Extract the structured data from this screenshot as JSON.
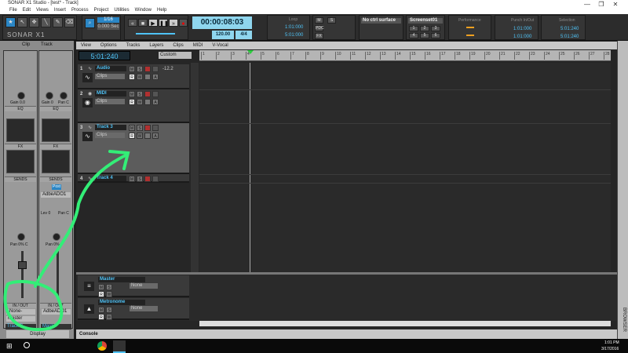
{
  "window": {
    "title": "SONAR X1 Studio - [test* - Track]",
    "minimize": "—",
    "restore": "❐",
    "close": "✕"
  },
  "menu": [
    "File",
    "Edit",
    "Views",
    "Insert",
    "Process",
    "Project",
    "Utilities",
    "Window",
    "Help"
  ],
  "toolbar": {
    "logo": "SONAR X1",
    "snap_value": "1/16",
    "snap_sec": "0.000 Sec",
    "time": "00:00:08:03",
    "tempo": "120.00",
    "meter": "4/4",
    "loop_label": "Loop",
    "loop_start": "1:01:000",
    "loop_end": "5:01:000",
    "ctrl_surface": "No ctrl surface",
    "screenset": "Screenset01",
    "screenset_buttons": [
      "1",
      "2",
      "3",
      "4",
      "5",
      "6"
    ],
    "performance_label": "Performance",
    "punch_label": "Punch In/Out",
    "punch_start": "1:01:000",
    "punch_end": "1:01:000",
    "selection_label": "Selection",
    "sel_start": "5:01:240",
    "sel_end": "5:01:240",
    "mute": "M",
    "solo": "S",
    "pdc": "PDC",
    "fx": "FX"
  },
  "inspector": {
    "tabs": [
      "Clip",
      "Track"
    ],
    "gain_left": "Gain 0.0",
    "gain_right": "Gain 0",
    "pan_right_top": "Pan C",
    "eq": "EQ",
    "fx": "FX",
    "sends": "SENDS",
    "send_post": "Post",
    "send_target": "AdbeADO1",
    "send_lev": "Lev 0",
    "send_pan": "Pan C",
    "pan_left": "Pan 0% C",
    "pan_right": "Pan 0%",
    "in_out": "IN / OUT",
    "input_left": "-None-",
    "output_left": "Master",
    "input_right": "AdbeADO1",
    "strip_name_left": "Track 3",
    "strip_name_right": "Master",
    "display": "Display"
  },
  "trackview": {
    "menus": [
      "View",
      "Options",
      "Tracks",
      "Layers",
      "Clips",
      "MIDI",
      "V-Vocal"
    ],
    "clock": "5:01:240",
    "custom": "Custom",
    "ruler": [
      "1",
      "2",
      "3",
      "4",
      "5",
      "6",
      "7",
      "8",
      "9",
      "10",
      "11",
      "12",
      "13",
      "14",
      "15",
      "16",
      "17",
      "18",
      "19",
      "20",
      "21",
      "22",
      "23",
      "24",
      "25",
      "26",
      "27",
      "28"
    ],
    "tracks": [
      {
        "num": "1",
        "name": "Audio",
        "clip": "Clips",
        "level": "-12.2"
      },
      {
        "num": "2",
        "name": "MIDI",
        "clip": "Clips",
        "level": ""
      },
      {
        "num": "3",
        "name": "Track 3",
        "clip": "Clips",
        "level": ""
      },
      {
        "num": "4",
        "name": "Track 4",
        "clip": "",
        "level": ""
      }
    ],
    "buses": [
      {
        "name": "Master",
        "out": "None"
      },
      {
        "name": "Metronome",
        "out": "None"
      }
    ],
    "btn": {
      "m": "M",
      "s": "S",
      "r": "R",
      "w": "W",
      "a": "A"
    }
  },
  "console": "Console",
  "browser": "BROWSER",
  "taskbar": {
    "time": "1:01 PM",
    "date": "3/17/2016"
  },
  "annotation_color": "#33ee77"
}
